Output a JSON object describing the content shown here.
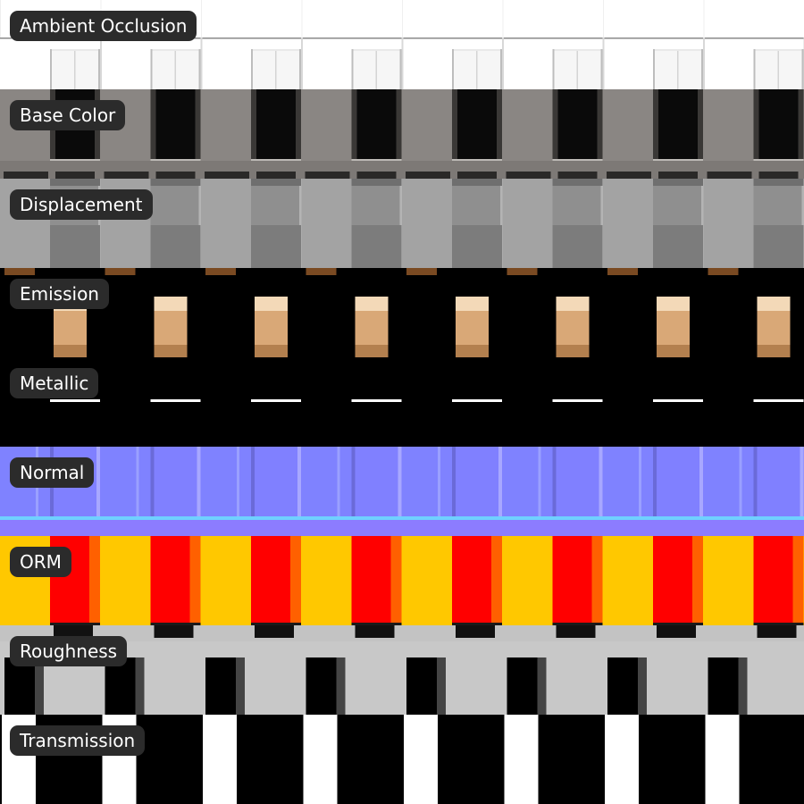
{
  "channels": [
    {
      "id": "ao",
      "label": "Ambient Occlusion"
    },
    {
      "id": "base",
      "label": "Base Color"
    },
    {
      "id": "disp",
      "label": "Displacement"
    },
    {
      "id": "emis",
      "label": "Emission"
    },
    {
      "id": "metal",
      "label": "Metallic"
    },
    {
      "id": "normal",
      "label": "Normal"
    },
    {
      "id": "orm",
      "label": "ORM"
    },
    {
      "id": "rough",
      "label": "Roughness"
    },
    {
      "id": "trans",
      "label": "Transmission"
    }
  ],
  "colors": {
    "label_bg": "#2b2b2b",
    "label_text": "#ffffff",
    "ao_bg": "#ffffff",
    "base_wall": "#8a8683",
    "disp_bg": "#9a9a9a",
    "emission_window": "#d9a877",
    "metallic_line": "#ffffff",
    "normal_bg": "#8080ff",
    "orm_bg": "#ffc800",
    "orm_window": "#ff0000",
    "orm_frame": "#ff6000",
    "rough_wall": "#c8c8c8",
    "transmission_white": "#ffffff"
  }
}
